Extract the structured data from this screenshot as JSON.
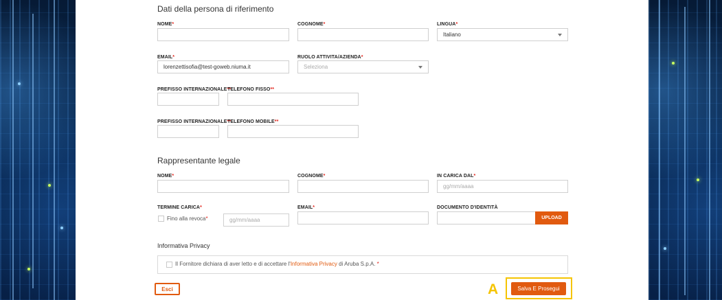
{
  "referente": {
    "title": "Dati della persona di riferimento",
    "nome_label": "NOME",
    "cognome_label": "COGNOME",
    "lingua_label": "LINGUA",
    "lingua_value": "Italiano",
    "email_label": "EMAIL",
    "email_value": "lorenzettisofia@test-goweb.niuma.it",
    "ruolo_label": "RUOLO ATTIVITA/AZIENDA",
    "ruolo_placeholder": "Seleziona",
    "prefisso1_label": "PREFISSO INTERNAZIONALE",
    "telefono_fisso_label": "TELEFONO FISSO",
    "prefisso2_label": "PREFISSO INTERNAZIONALE",
    "telefono_mobile_label": "TELEFONO MOBILE"
  },
  "rappresentante": {
    "title": "Rappresentante legale",
    "nome_label": "NOME",
    "cognome_label": "COGNOME",
    "in_carica_label": "IN CARICA DAL",
    "in_carica_placeholder": "gg/mm/aaaa",
    "termine_label": "TERMINE CARICA",
    "fino_revoca_label": "Fino alla revoca",
    "termine_placeholder": "gg/mm/aaaa",
    "email_label": "EMAIL",
    "documento_label": "DOCUMENTO D'IDENTITÀ",
    "upload_label": "UPLOAD"
  },
  "privacy": {
    "title": "Informativa Privacy",
    "text_before": "Il Fornitore dichiara di aver letto e di accettare l'",
    "link_text": "Informativa Privacy",
    "text_after": " di Aruba S.p.A. "
  },
  "required_mark": "*",
  "double_required_mark": "**",
  "buttons": {
    "esci": "Esci",
    "salva": "Salva E Prosegui"
  },
  "annotation_marker": "A",
  "colors": {
    "accent": "#e15a0f",
    "required": "#e2231a",
    "highlight": "#f5c400"
  }
}
